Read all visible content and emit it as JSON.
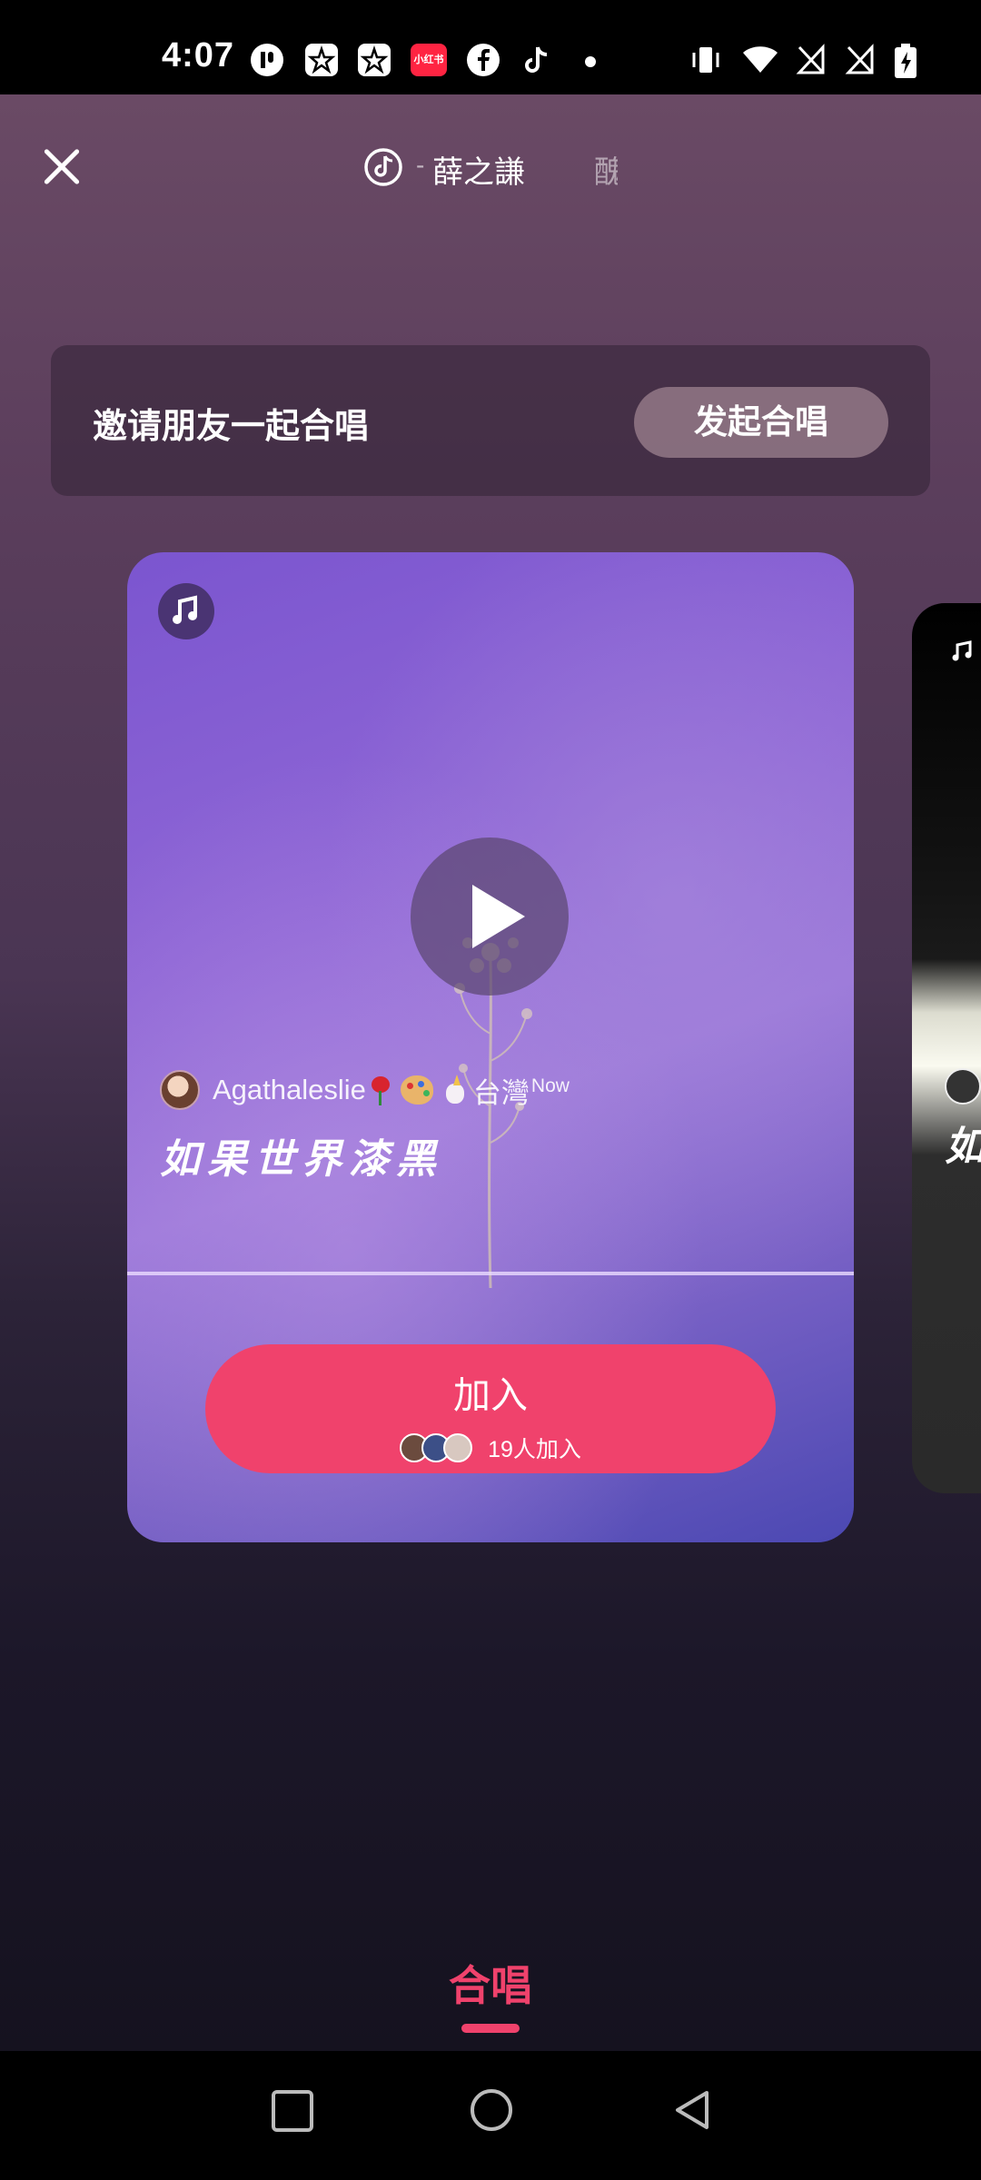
{
  "status_bar": {
    "time": "4:07",
    "icons": [
      "notification-p-icon",
      "star-icon",
      "star-icon",
      "xiaohongshu-icon",
      "facebook-icon",
      "tiktok-icon",
      "dot-icon",
      "vibrate-icon",
      "wifi-icon",
      "no-signal-icon",
      "no-signal-icon",
      "battery-charging-icon"
    ],
    "xiaohongshu_label": "小红书"
  },
  "header": {
    "song_separator": "-",
    "artist": "薛之謙",
    "next_title_partial": "醜"
  },
  "invite": {
    "text": "邀请朋友一起合唱",
    "button_label": "发起合唱"
  },
  "card": {
    "author": "Agathaleslie",
    "location": "台灣",
    "location_tag": "Now",
    "lyric": "如果世界漆黑",
    "join_label": "加入",
    "join_count": "19人加入"
  },
  "card_next": {
    "lyric_partial": "如"
  },
  "tab": {
    "label": "合唱"
  },
  "colors": {
    "accent": "#f0426c",
    "card_purple": "#8f67d6",
    "invite_bg": "#322234"
  }
}
